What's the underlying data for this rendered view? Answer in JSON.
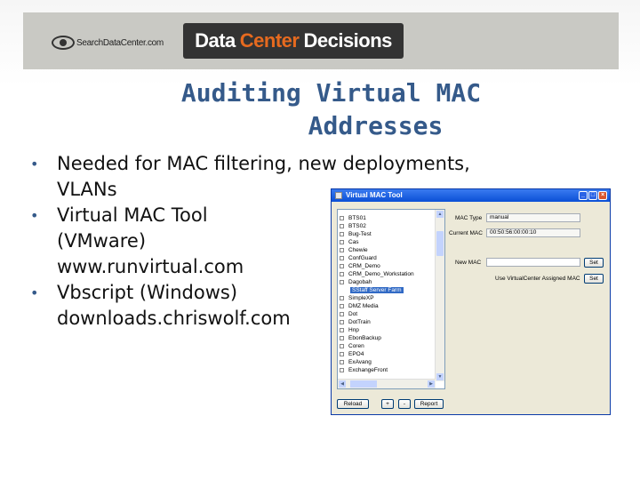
{
  "header": {
    "site_logo": "SearchDataCenter.com",
    "brand_part1": "Data",
    "brand_part2": "Center",
    "brand_part3": "Decisions",
    "brand_accent_color": "#e66a1f"
  },
  "slide": {
    "title_line1": "Auditing Virtual MAC",
    "title_line2": "Addresses",
    "bullets": [
      {
        "lines": [
          "Needed for MAC filtering, new deployments,",
          "VLANs"
        ]
      },
      {
        "lines": [
          "Virtual MAC Tool",
          "(VMware)",
          "www.runvirtual.com"
        ]
      },
      {
        "lines": [
          "Vbscript (Windows)",
          "downloads.chriswolf.com"
        ]
      }
    ]
  },
  "window": {
    "title": "Virtual MAC Tool",
    "tree_items": [
      {
        "label": "BTS01"
      },
      {
        "label": "BTS02"
      },
      {
        "label": "Bug-Test"
      },
      {
        "label": "Cas"
      },
      {
        "label": "Chewie"
      },
      {
        "label": "ConfGuard"
      },
      {
        "label": "CRM_Demo"
      },
      {
        "label": "CRM_Demo_Workstation"
      },
      {
        "label": "Dagobah"
      },
      {
        "label": "SStaff Server Farm"
      },
      {
        "label": "SimpleXP"
      },
      {
        "label": "DMZ Media"
      },
      {
        "label": "Dot"
      },
      {
        "label": "DotTrain"
      },
      {
        "label": "Hnp"
      },
      {
        "label": "EbonBackup"
      },
      {
        "label": "Coren"
      },
      {
        "label": "EPO4"
      },
      {
        "label": "ExAvang"
      },
      {
        "label": "ExchangeFront"
      }
    ],
    "mac_type_label": "MAC Type",
    "mac_type_value": "manual",
    "current_mac_label": "Current MAC",
    "current_mac_value": "00:50:56:00:00:10",
    "new_mac_label": "New MAC",
    "new_mac_value": "",
    "set_label": "Set",
    "use_assigned_label": "Use VirtualCenter Assigned MAC",
    "buttons": {
      "reload": "Reload",
      "plus": "+",
      "minus": "-",
      "report": "Report"
    },
    "title_buttons": {
      "min": "_",
      "max": "□",
      "close": "×"
    }
  }
}
